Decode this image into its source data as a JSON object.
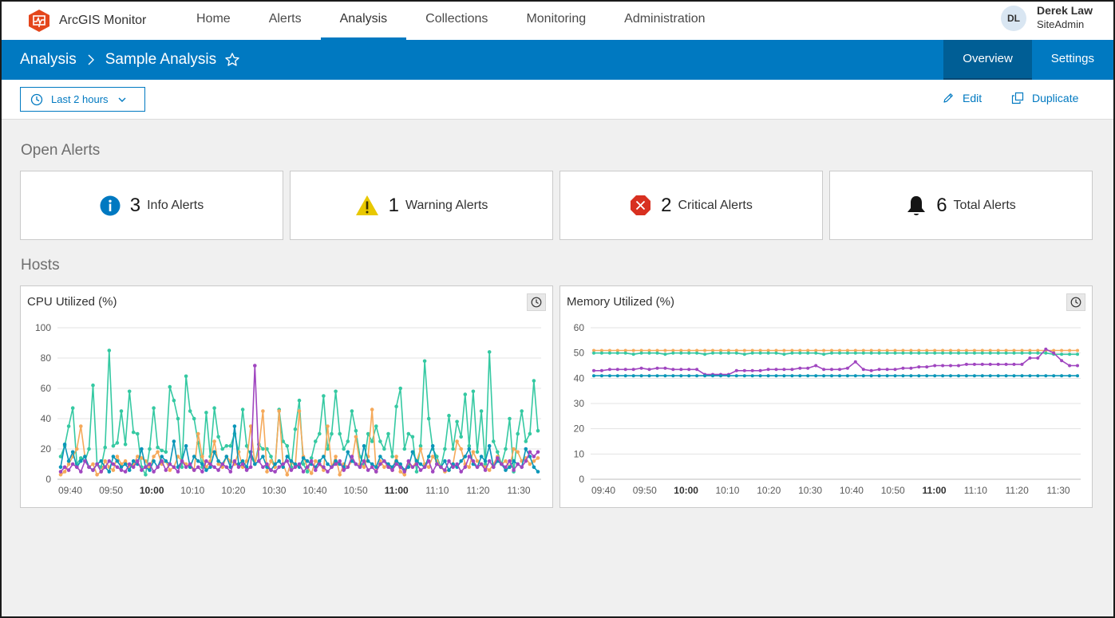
{
  "app": {
    "name": "ArcGIS Monitor",
    "logo_icon": "monitor-logo-icon",
    "brand_color": "#e4461c"
  },
  "nav": {
    "items": [
      {
        "label": "Home",
        "active": false
      },
      {
        "label": "Alerts",
        "active": false
      },
      {
        "label": "Analysis",
        "active": true
      },
      {
        "label": "Collections",
        "active": false
      },
      {
        "label": "Monitoring",
        "active": false
      },
      {
        "label": "Administration",
        "active": false
      }
    ]
  },
  "user": {
    "initials": "DL",
    "name": "Derek Law",
    "role": "SiteAdmin"
  },
  "breadcrumb": {
    "root": "Analysis",
    "current": "Sample Analysis",
    "favorite_icon": "star-icon"
  },
  "subtabs": [
    {
      "label": "Overview",
      "active": true
    },
    {
      "label": "Settings",
      "active": false
    }
  ],
  "toolbar": {
    "time_range": "Last 2 hours",
    "edit_label": "Edit",
    "duplicate_label": "Duplicate"
  },
  "open_alerts": {
    "title": "Open Alerts",
    "cards": [
      {
        "icon": "info-icon",
        "count": "3",
        "label": "Info Alerts",
        "color": "#0079c1"
      },
      {
        "icon": "warning-icon",
        "count": "1",
        "label": "Warning Alerts",
        "color": "#e8c800"
      },
      {
        "icon": "critical-icon",
        "count": "2",
        "label": "Critical Alerts",
        "color": "#d83020"
      },
      {
        "icon": "bell-icon",
        "count": "6",
        "label": "Total Alerts",
        "color": "#151515"
      }
    ]
  },
  "hosts": {
    "title": "Hosts"
  },
  "colors": {
    "accent": "#0079c1",
    "series_teal": "#35c9a2",
    "series_orange": "#f5a95a",
    "series_blue": "#0a96b8",
    "series_purple": "#a046c0"
  },
  "chart_data": [
    {
      "type": "line",
      "title": "CPU Utilized (%)",
      "x_labels": [
        "09:40",
        "09:50",
        "10:00",
        "10:10",
        "10:20",
        "10:30",
        "10:40",
        "10:50",
        "11:00",
        "11:10",
        "11:20",
        "11:30"
      ],
      "bold_labels": [
        "10:00",
        "11:00"
      ],
      "ylim": [
        0,
        100
      ],
      "yticks": [
        0,
        20,
        40,
        60,
        80,
        100
      ],
      "grid": true,
      "series": [
        {
          "color": "#35c9a2",
          "values": [
            15,
            22,
            35,
            47,
            10,
            14,
            12,
            20,
            62,
            10,
            8,
            21,
            85,
            22,
            24,
            45,
            23,
            58,
            31,
            30,
            8,
            3,
            20,
            47,
            21,
            19,
            18,
            61,
            52,
            40,
            8,
            68,
            45,
            40,
            24,
            8,
            44,
            15,
            47,
            28,
            20,
            22,
            22,
            30,
            18,
            46,
            22,
            15,
            10,
            23,
            20,
            20,
            15,
            8,
            46,
            25,
            22,
            8,
            33,
            52,
            10,
            5,
            14,
            25,
            30,
            55,
            20,
            30,
            58,
            30,
            20,
            25,
            45,
            32,
            15,
            10,
            30,
            25,
            35,
            25,
            20,
            30,
            15,
            48,
            60,
            20,
            30,
            28,
            5,
            22,
            78,
            40,
            20,
            15,
            8,
            20,
            42,
            20,
            38,
            28,
            56,
            22,
            58,
            18,
            45,
            10,
            84,
            25,
            18,
            10,
            20,
            40,
            5,
            30,
            45,
            25,
            30,
            65,
            32
          ]
        },
        {
          "color": "#f5a95a",
          "values": [
            3,
            5,
            10,
            15,
            20,
            35,
            15,
            8,
            10,
            3,
            5,
            12,
            8,
            6,
            15,
            10,
            12,
            8,
            10,
            15,
            14,
            12,
            8,
            15,
            18,
            10,
            12,
            6,
            8,
            15,
            12,
            10,
            8,
            6,
            30,
            15,
            8,
            12,
            25,
            10,
            8,
            15,
            12,
            10,
            18,
            8,
            12,
            35,
            10,
            20,
            45,
            5,
            12,
            8,
            45,
            10,
            3,
            12,
            8,
            45,
            15,
            8,
            4,
            12,
            10,
            6,
            35,
            8,
            15,
            3,
            10,
            8,
            12,
            28,
            10,
            8,
            15,
            46,
            5,
            12,
            8,
            10,
            6,
            15,
            5,
            3,
            10,
            8,
            12,
            20,
            10,
            8,
            15,
            12,
            8,
            5,
            6,
            10,
            25,
            20,
            10,
            8,
            18,
            12,
            10,
            8,
            6,
            10,
            15,
            10,
            12,
            8,
            20,
            18,
            12,
            14,
            10,
            12,
            14
          ]
        },
        {
          "color": "#0a96b8",
          "values": [
            8,
            23,
            12,
            18,
            8,
            12,
            15,
            8,
            6,
            10,
            12,
            8,
            5,
            15,
            12,
            8,
            10,
            6,
            12,
            10,
            20,
            8,
            6,
            12,
            8,
            15,
            12,
            10,
            25,
            8,
            12,
            22,
            8,
            15,
            12,
            10,
            6,
            8,
            18,
            12,
            10,
            15,
            8,
            35,
            10,
            12,
            8,
            18,
            10,
            12,
            15,
            8,
            6,
            10,
            12,
            8,
            15,
            12,
            10,
            8,
            14,
            12,
            10,
            8,
            12,
            15,
            10,
            8,
            12,
            10,
            8,
            18,
            12,
            10,
            8,
            22,
            12,
            10,
            8,
            15,
            12,
            10,
            8,
            12,
            10,
            6,
            8,
            18,
            12,
            10,
            8,
            15,
            22,
            10,
            8,
            12,
            6,
            10,
            8,
            12,
            15,
            20,
            10,
            8,
            15,
            12,
            22,
            8,
            12,
            10,
            6,
            8,
            12,
            10,
            8,
            20,
            15,
            8,
            5
          ]
        },
        {
          "color": "#a046c0",
          "values": [
            5,
            8,
            6,
            10,
            8,
            5,
            12,
            8,
            6,
            10,
            5,
            8,
            12,
            10,
            8,
            6,
            5,
            10,
            8,
            12,
            6,
            8,
            10,
            5,
            8,
            12,
            6,
            10,
            8,
            5,
            12,
            8,
            10,
            6,
            8,
            5,
            12,
            10,
            8,
            6,
            10,
            8,
            5,
            12,
            8,
            10,
            6,
            8,
            75,
            12,
            8,
            10,
            6,
            5,
            8,
            10,
            12,
            6,
            8,
            10,
            5,
            8,
            12,
            6,
            10,
            8,
            5,
            8,
            10,
            12,
            6,
            8,
            15,
            10,
            8,
            12,
            6,
            8,
            5,
            10,
            12,
            8,
            6,
            10,
            8,
            5,
            12,
            8,
            10,
            6,
            8,
            12,
            5,
            10,
            8,
            6,
            12,
            8,
            10,
            5,
            8,
            15,
            12,
            8,
            10,
            6,
            12,
            8,
            14,
            10,
            8,
            12,
            6,
            10,
            8,
            12,
            18,
            15,
            18
          ]
        }
      ]
    },
    {
      "type": "line",
      "title": "Memory Utilized (%)",
      "x_labels": [
        "09:40",
        "09:50",
        "10:00",
        "10:10",
        "10:20",
        "10:30",
        "10:40",
        "10:50",
        "11:00",
        "11:10",
        "11:20",
        "11:30"
      ],
      "bold_labels": [
        "10:00",
        "11:00"
      ],
      "ylim": [
        0,
        60
      ],
      "yticks": [
        0,
        10,
        20,
        30,
        40,
        50,
        60
      ],
      "grid": true,
      "series": [
        {
          "color": "#f5a95a",
          "values": [
            51,
            51,
            51,
            51,
            51,
            51,
            51,
            51,
            51,
            51,
            51,
            51,
            51,
            51,
            51,
            51,
            51,
            51,
            51,
            51,
            51,
            51,
            51,
            51,
            51,
            51,
            51,
            51,
            51,
            51,
            51,
            51,
            51,
            51,
            51,
            51,
            51,
            51,
            51,
            51,
            51,
            51,
            51,
            51,
            51,
            51,
            51,
            51,
            51,
            51,
            51,
            51,
            51,
            51,
            51,
            51,
            51,
            51,
            51,
            51,
            51,
            51
          ]
        },
        {
          "color": "#35c9a2",
          "values": [
            50,
            50,
            50,
            50,
            50,
            49.5,
            50,
            50,
            50,
            49.5,
            50,
            50,
            50,
            50,
            49.5,
            50,
            50,
            50,
            50,
            49.5,
            50,
            50,
            50,
            50,
            49.5,
            50,
            50,
            50,
            50,
            49.5,
            50,
            50,
            50,
            50,
            50,
            50,
            50,
            50,
            50,
            50,
            50,
            50,
            50,
            50,
            50,
            50,
            50,
            50,
            50,
            50,
            50,
            50,
            50,
            50,
            50,
            50,
            50,
            50,
            49.5,
            49.5,
            49.5,
            49.5
          ]
        },
        {
          "color": "#a046c0",
          "values": [
            43,
            43,
            43.5,
            43.5,
            43.5,
            43.5,
            44,
            43.5,
            44,
            44,
            43.5,
            43.5,
            43.5,
            43.5,
            41.5,
            41.5,
            41.5,
            41.5,
            43,
            43,
            43,
            43,
            43.5,
            43.5,
            43.5,
            43.5,
            44,
            44,
            45,
            43.5,
            43.5,
            43.5,
            44,
            46.5,
            43.5,
            43,
            43.5,
            43.5,
            43.5,
            44,
            44,
            44.5,
            44.5,
            45,
            45,
            45,
            45,
            45.5,
            45.5,
            45.5,
            45.5,
            45.5,
            45.5,
            45.5,
            45.5,
            48,
            48,
            51.5,
            50,
            47,
            45,
            45
          ]
        },
        {
          "color": "#0a96b8",
          "values": [
            41,
            41,
            41,
            41,
            41,
            41,
            41,
            41,
            41,
            41,
            41,
            41,
            41,
            41,
            41,
            41,
            41,
            41,
            41,
            41,
            41,
            41,
            41,
            41,
            41,
            41,
            41,
            41,
            41,
            41,
            41,
            41,
            41,
            41,
            41,
            41,
            41,
            41,
            41,
            41,
            41,
            41,
            41,
            41,
            41,
            41,
            41,
            41,
            41,
            41,
            41,
            41,
            41,
            41,
            41,
            41,
            41,
            41,
            41,
            41,
            41,
            41
          ]
        }
      ]
    }
  ]
}
